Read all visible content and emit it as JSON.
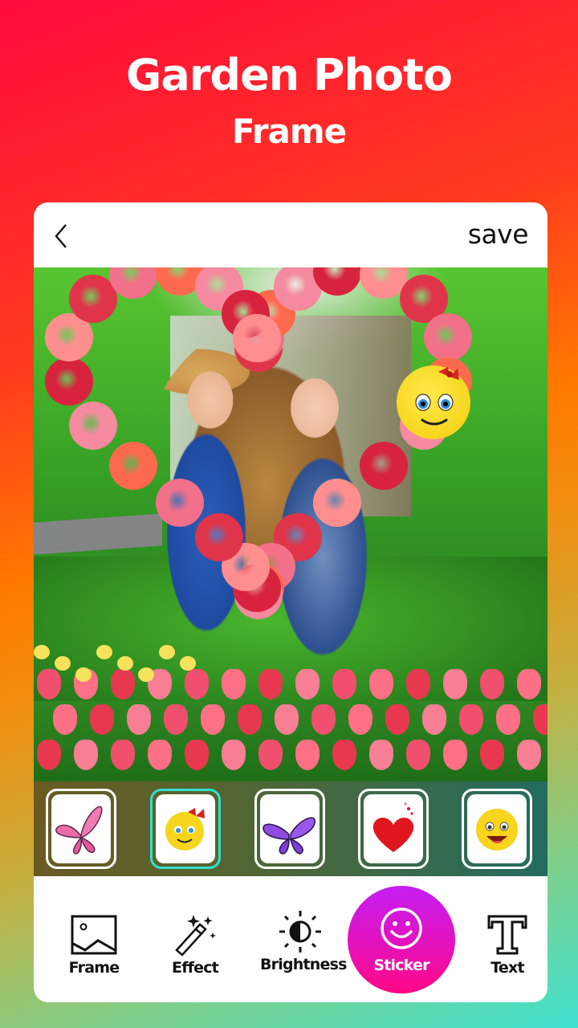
{
  "hero": {
    "title": "Garden Photo",
    "subtitle": "Frame"
  },
  "topbar": {
    "back_icon": "chevron-left-icon",
    "save_label": "save"
  },
  "photo": {
    "description": "Two women in a garden inside a rose heart frame with a smiley sticker",
    "applied_sticker": "smiley-with-bow"
  },
  "stickers": [
    {
      "name": "pink-butterfly",
      "selected": false
    },
    {
      "name": "smiley-with-bow",
      "selected": true
    },
    {
      "name": "purple-butterfly",
      "selected": false
    },
    {
      "name": "red-glitter-heart",
      "selected": false
    },
    {
      "name": "laughing-smiley",
      "selected": false
    }
  ],
  "toolbar": {
    "items": [
      {
        "label": "Frame",
        "icon": "image-icon",
        "active": false
      },
      {
        "label": "Effect",
        "icon": "magic-wand-icon",
        "active": false
      },
      {
        "label": "Brightness",
        "icon": "brightness-icon",
        "active": false
      },
      {
        "label": "Sticker",
        "icon": "smiley-icon",
        "active": true
      },
      {
        "label": "Text",
        "icon": "text-icon",
        "active": false
      }
    ]
  },
  "colors": {
    "active_tool_gradient_top": "#c41ef2",
    "active_tool_gradient_bottom": "#ff0884",
    "selected_sticker_border": "#2fe0d2",
    "background_top": "#ff0a3c",
    "background_bottom": "#3fe0cf"
  }
}
